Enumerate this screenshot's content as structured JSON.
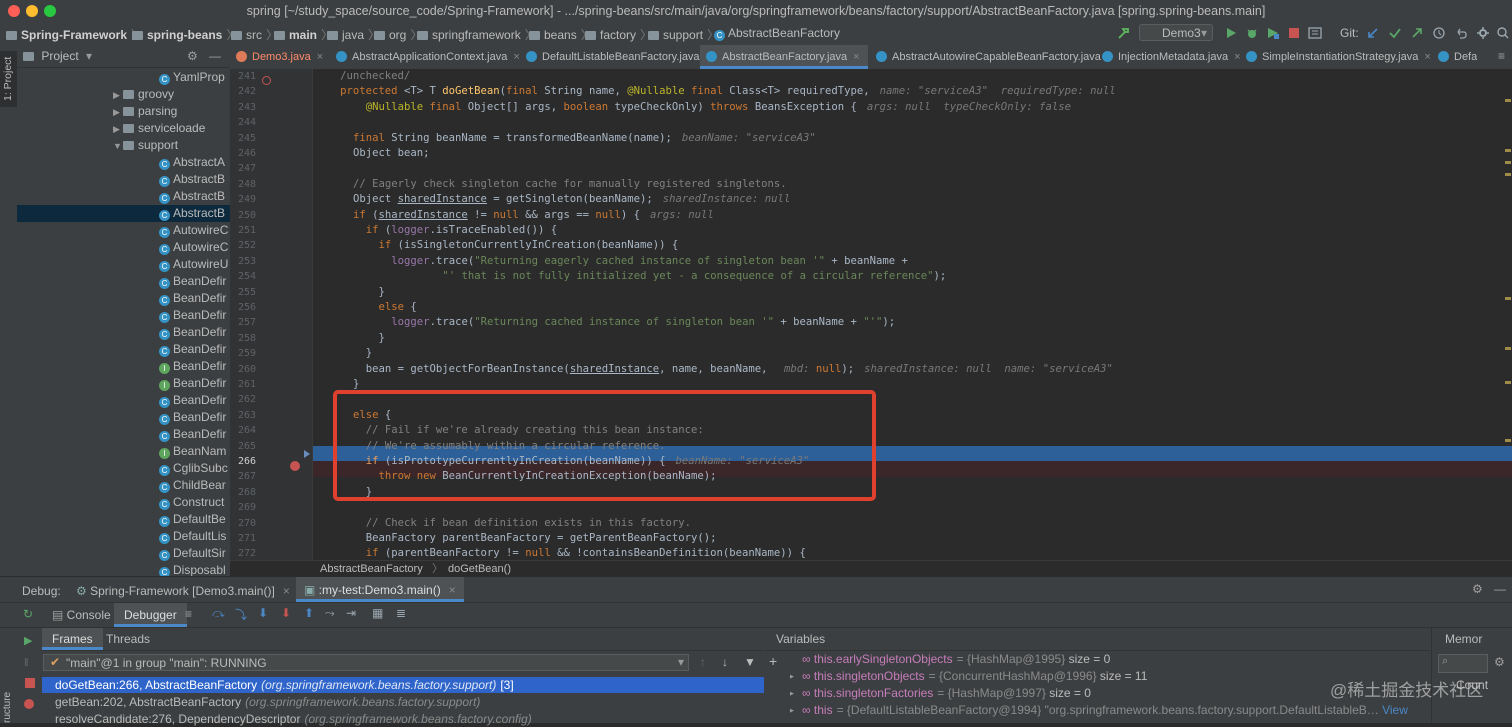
{
  "window": {
    "title": "spring [~/study_space/source_code/Spring-Framework] - .../spring-beans/src/main/java/org/springframework/beans/factory/support/AbstractBeanFactory.java [spring.spring-beans.main]"
  },
  "navbar": {
    "crumbs": [
      "Spring-Framework",
      "spring-beans",
      "src",
      "main",
      "java",
      "org",
      "springframework",
      "beans",
      "factory",
      "support",
      "AbstractBeanFactory"
    ],
    "run_config": "Demo3",
    "git_label": "Git:"
  },
  "left_strip": {
    "project_tab": "1: Project"
  },
  "project_panel": {
    "title": "Project",
    "items": [
      {
        "label": "YamlProp",
        "kind": "class"
      },
      {
        "label": "groovy",
        "kind": "folder"
      },
      {
        "label": "parsing",
        "kind": "folder"
      },
      {
        "label": "serviceloade",
        "kind": "folder"
      },
      {
        "label": "support",
        "kind": "folder-open"
      },
      {
        "label": "AbstractA",
        "kind": "class"
      },
      {
        "label": "AbstractB",
        "kind": "class"
      },
      {
        "label": "AbstractB",
        "kind": "class"
      },
      {
        "label": "AbstractB",
        "kind": "class"
      },
      {
        "label": "AutowireC",
        "kind": "class"
      },
      {
        "label": "AutowireC",
        "kind": "class"
      },
      {
        "label": "AutowireU",
        "kind": "class"
      },
      {
        "label": "BeanDefir",
        "kind": "class"
      },
      {
        "label": "BeanDefir",
        "kind": "class"
      },
      {
        "label": "BeanDefir",
        "kind": "class"
      },
      {
        "label": "BeanDefir",
        "kind": "class"
      },
      {
        "label": "BeanDefir",
        "kind": "class"
      },
      {
        "label": "BeanDefir",
        "kind": "interface"
      },
      {
        "label": "BeanDefir",
        "kind": "interface"
      },
      {
        "label": "BeanDefir",
        "kind": "class"
      },
      {
        "label": "BeanDefir",
        "kind": "class"
      },
      {
        "label": "BeanDefir",
        "kind": "class"
      },
      {
        "label": "BeanNam",
        "kind": "interface"
      },
      {
        "label": "CglibSubc",
        "kind": "class"
      },
      {
        "label": "ChildBear",
        "kind": "class"
      },
      {
        "label": "Construct",
        "kind": "class"
      },
      {
        "label": "DefaultBe",
        "kind": "class"
      },
      {
        "label": "DefaultLis",
        "kind": "class"
      },
      {
        "label": "DefaultSir",
        "kind": "class"
      },
      {
        "label": "Disposabl",
        "kind": "class"
      }
    ]
  },
  "editor": {
    "tabs": [
      {
        "label": "Demo3.java",
        "special": "demo"
      },
      {
        "label": "AbstractApplicationContext.java"
      },
      {
        "label": "DefaultListableBeanFactory.java"
      },
      {
        "label": "AbstractBeanFactory.java",
        "special": "active"
      },
      {
        "label": "AbstractAutowireCapableBeanFactory.java"
      },
      {
        "label": "InjectionMetadata.java"
      },
      {
        "label": "SimpleInstantiationStrategy.java"
      },
      {
        "label": "Defa"
      }
    ],
    "breadcrumb": [
      "AbstractBeanFactory",
      "doGetBean()"
    ],
    "line_numbers": [
      "241",
      "242",
      "243",
      "244",
      "245",
      "246",
      "247",
      "248",
      "249",
      "250",
      "251",
      "252",
      "253",
      "254",
      "255",
      "256",
      "257",
      "258",
      "259",
      "260",
      "261",
      "262",
      "263",
      "264",
      "265",
      "266",
      "267",
      "268",
      "269",
      "270",
      "271",
      "272",
      "273"
    ],
    "code": {
      "l241": "/unchecked/",
      "l242_a": "protected ",
      "l242_b": "<T> T ",
      "l242_c": "doGetBean",
      "l242_d": "(",
      "l242_e": "final ",
      "l242_f": "String name, ",
      "l242_g": "@Nullable ",
      "l242_h": "final ",
      "l242_i": "Class<T> requiredType,",
      "l242_hint": "name: \"serviceA3\"  requiredType: null",
      "l243_a": "@Nullable ",
      "l243_b": "final ",
      "l243_c": "Object[] args, ",
      "l243_d": "boolean ",
      "l243_e": "typeCheckOnly) ",
      "l243_f": "throws ",
      "l243_g": "BeansException {",
      "l243_hint": "args: null  typeCheckOnly: false",
      "l245_a": "final ",
      "l245_b": "String beanName = transformedBeanName(name);",
      "l245_hint": "beanName: \"serviceA3\"",
      "l246": "Object bean;",
      "l248": "// Eagerly check singleton cache for manually registered singletons.",
      "l249_a": "Object ",
      "l249_b": "sharedInstance",
      "l249_c": " = getSingleton(beanName);",
      "l249_hint": "sharedInstance: null",
      "l250_a": "if ",
      "l250_b": "(",
      "l250_c": "sharedInstance",
      "l250_d": " != ",
      "l250_e": "null ",
      "l250_f": "&& args == ",
      "l250_g": "null",
      "l250_h": ") {",
      "l250_hint": "args: null",
      "l251_a": "if ",
      "l251_b": "(",
      "l251_c": "logger",
      "l251_d": ".isTraceEnabled()) {",
      "l252_a": "if ",
      "l252_b": "(isSingletonCurrentlyInCreation(beanName)) {",
      "l253_a": "logger",
      "l253_b": ".trace(",
      "l253_c": "\"Returning eagerly cached instance of singleton bean '\"",
      "l253_d": " + beanName +",
      "l254_a": "\"' that is not fully initialized yet - a consequence of a circular reference\"",
      "l254_b": ");",
      "l255": "}",
      "l256_a": "else ",
      "l256_b": "{",
      "l257_a": "logger",
      "l257_b": ".trace(",
      "l257_c": "\"Returning cached instance of singleton bean '\"",
      "l257_d": " + beanName + ",
      "l257_e": "\"'\"",
      "l257_f": ");",
      "l258": "}",
      "l259": "}",
      "l260_a": "bean = getObjectForBeanInstance(",
      "l260_b": "sharedInstance",
      "l260_c": ", name, beanName, ",
      "l260_d": "mbd:",
      "l260_e": " null",
      "l260_f": ");",
      "l260_hint": "sharedInstance: null  name: \"serviceA3\"",
      "l261": "}",
      "l263_a": "else ",
      "l263_b": "{",
      "l264": "// Fail if we're already creating this bean instance:",
      "l265": "// We're assumably within a circular reference.",
      "l266_a": "if ",
      "l266_b": "(isPrototypeCurrentlyInCreation(beanName)) {",
      "l266_hint": "beanName: \"serviceA3\"",
      "l267_a": "throw new ",
      "l267_b": "BeanCurrentlyInCreationException(beanName);",
      "l268": "}",
      "l270": "// Check if bean definition exists in this factory.",
      "l271": "BeanFactory parentBeanFactory = getParentBeanFactory();",
      "l272_a": "if ",
      "l272_b": "(parentBeanFactory != ",
      "l272_c": "null ",
      "l272_d": "&& !containsBeanDefinition(beanName)) {"
    }
  },
  "debug": {
    "label": "Debug:",
    "sessions": [
      "Spring-Framework [Demo3.main()]",
      ":my-test:Demo3.main()"
    ],
    "tabs": [
      "Console",
      "Debugger"
    ],
    "subtabs": [
      "Frames",
      "Threads"
    ],
    "thread": "\"main\"@1 in group \"main\": RUNNING",
    "frames": [
      {
        "method": "doGetBean:266, AbstractBeanFactory",
        "pkg": "(org.springframework.beans.factory.support)",
        "extra": "[3]"
      },
      {
        "method": "getBean:202, AbstractBeanFactory",
        "pkg": "(org.springframework.beans.factory.support)",
        "extra": ""
      },
      {
        "method": "resolveCandidate:276, DependencyDescriptor",
        "pkg": "(org.springframework.beans.factory.config)",
        "extra": ""
      }
    ],
    "variables_title": "Variables",
    "memory_tab": "Memor",
    "count_label": "Count",
    "variables": [
      {
        "name": "this.earlySingletonObjects",
        "value": "= {HashMap@1995}",
        "size": " size = 0"
      },
      {
        "name": "this.singletonObjects",
        "value": "= {ConcurrentHashMap@1996}",
        "size": " size = 11"
      },
      {
        "name": "this.singletonFactories",
        "value": "= {HashMap@1997}",
        "size": " size = 0"
      },
      {
        "name": "this",
        "value": "= {DefaultListableBeanFactory@1994} \"org.springframework.beans.factory.support.DefaultListableB…",
        "size": " View"
      }
    ]
  },
  "watermark": "@稀土掘金技术社区",
  "colors": {
    "accent": "#2f65ca",
    "highlight_line": "#2d6099",
    "annotation_box": "#e0412f"
  }
}
